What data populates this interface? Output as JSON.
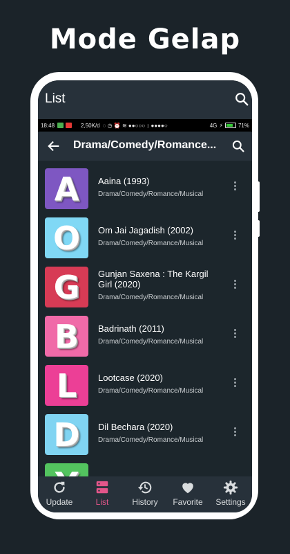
{
  "headline": "Mode Gelap",
  "appbar": {
    "title": "List"
  },
  "statusbar": {
    "time": "18:48",
    "speed": "2,50K/d",
    "network": "4G",
    "battery": "71%",
    "battery_level": 0.71
  },
  "subbar": {
    "title": "Drama/Comedy/Romance..."
  },
  "items": [
    {
      "letter": "A",
      "title": "Aaina (1993)",
      "subtitle": "Drama/Comedy/Romance/Musical",
      "color": "#7e57c2"
    },
    {
      "letter": "O",
      "title": "Om Jai Jagadish (2002)",
      "subtitle": "Drama/Comedy/Romance/Musical",
      "color": "#80d8f5"
    },
    {
      "letter": "G",
      "title": "Gunjan Saxena : The Kargil Girl (2020)",
      "subtitle": "Drama/Comedy/Romance/Musical",
      "color": "#d73b55"
    },
    {
      "letter": "B",
      "title": "Badrinath (2011)",
      "subtitle": "Drama/Comedy/Romance/Musical",
      "color": "#f06aa8"
    },
    {
      "letter": "L",
      "title": "Lootcase (2020)",
      "subtitle": "Drama/Comedy/Romance/Musical",
      "color": "#ec3f96"
    },
    {
      "letter": "D",
      "title": "Dil Bechara (2020)",
      "subtitle": "Drama/Comedy/Romance/Musical",
      "color": "#80d4f2"
    },
    {
      "letter": "Y",
      "title": "",
      "subtitle": "",
      "color": "#53c45f"
    }
  ],
  "bottomnav": [
    {
      "label": "Update",
      "icon": "refresh-icon"
    },
    {
      "label": "List",
      "icon": "list-icon",
      "active": true
    },
    {
      "label": "History",
      "icon": "history-icon"
    },
    {
      "label": "Favorite",
      "icon": "heart-icon"
    },
    {
      "label": "Settings",
      "icon": "gear-icon"
    }
  ],
  "colors": {
    "background": "#1b2329",
    "bar": "#27313a",
    "screen": "#1c262c",
    "accent": "#e3568a"
  }
}
